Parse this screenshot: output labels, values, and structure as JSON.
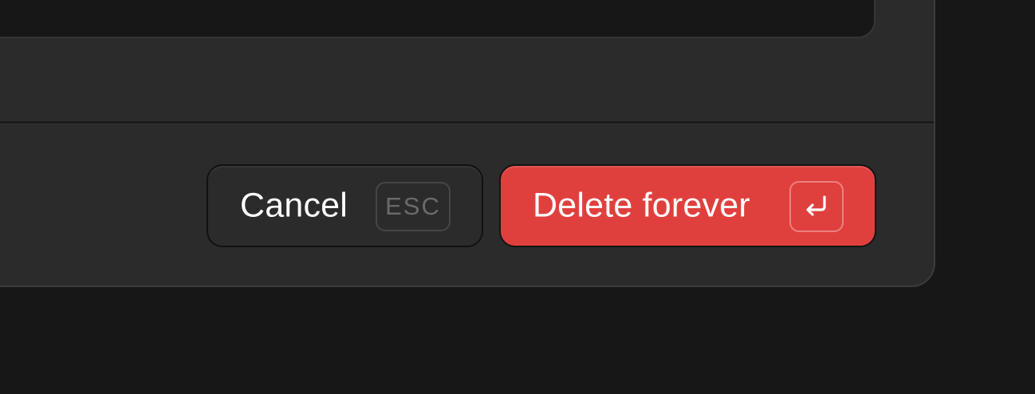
{
  "dialog": {
    "actions": {
      "cancel_label": "Cancel",
      "cancel_shortcut": "ESC",
      "delete_label": "Delete forever",
      "delete_shortcut_icon": "enter-return-icon"
    }
  },
  "colors": {
    "background": "#171717",
    "dialog_surface": "#2a2b2a",
    "danger": "#e0403d",
    "cancel_surface": "#2b2b2b"
  }
}
